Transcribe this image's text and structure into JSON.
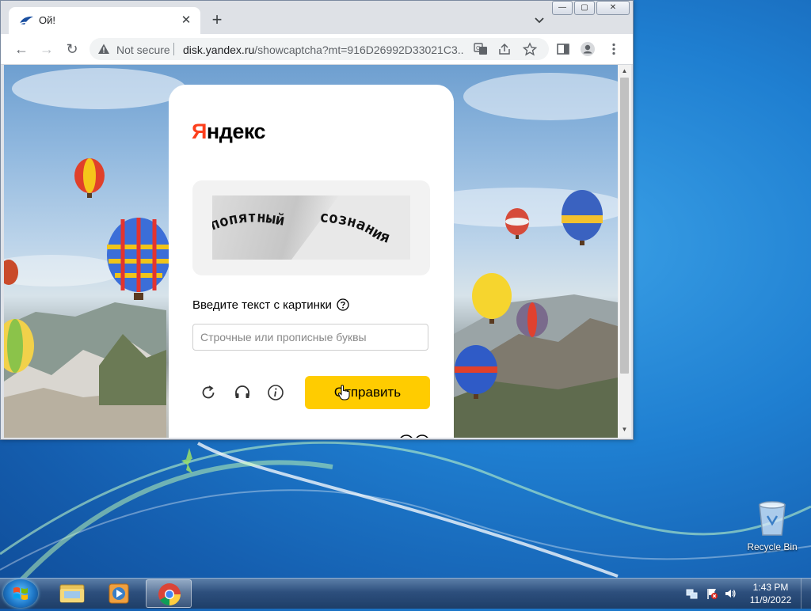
{
  "browser": {
    "tab": {
      "title": "Ой!",
      "close": "✕"
    },
    "new_tab": "+",
    "tab_search_icon": "chevron-down-icon",
    "window_buttons": {
      "minimize": "—",
      "maximize": "▢",
      "close": "✕"
    },
    "nav": {
      "back": "←",
      "forward": "→",
      "reload": "↻"
    },
    "address": {
      "security_label": "Not secure",
      "url_host": "disk.yandex.ru",
      "url_rest": "/showcaptcha?mt=916D26992D33021C3..."
    }
  },
  "page": {
    "logo": {
      "first_letter": "Я",
      "rest": "ндекс"
    },
    "captcha_text": {
      "word1": "попятный",
      "word2": "сознания"
    },
    "prompt_label": "Введите текст с картинки",
    "input": {
      "value": "",
      "placeholder": "Строчные или прописные буквы"
    },
    "submit_label": "Отправить",
    "colors": {
      "accent": "#ffcc00",
      "logo_red": "#fc3f1d"
    }
  },
  "desktop": {
    "recycle_bin_label": "Recycle Bin",
    "clock": {
      "time": "1:43 PM",
      "date": "11/9/2022"
    }
  }
}
